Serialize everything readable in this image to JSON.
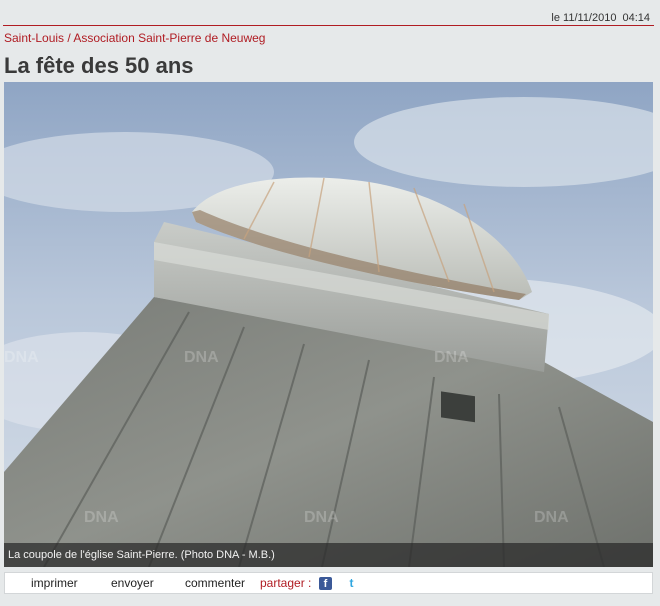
{
  "header": {
    "date": "le 11/11/2010",
    "time": "04:14"
  },
  "breadcrumb": "Saint-Louis / Association Saint-Pierre de Neuweg",
  "article": {
    "title": "La fête des 50 ans"
  },
  "photo": {
    "caption": "La coupole de l'église Saint-Pierre. (Photo DNA - M.B.)",
    "watermark": "DNA"
  },
  "toolbar": {
    "print": "imprimer",
    "send": "envoyer",
    "comment": "commenter",
    "share": "partager :",
    "facebook_icon": "facebook-icon",
    "twitter_icon": "twitter-icon"
  },
  "colors": {
    "accent": "#b01c23",
    "background": "#e6e9ea",
    "title": "#3a3a3a"
  }
}
